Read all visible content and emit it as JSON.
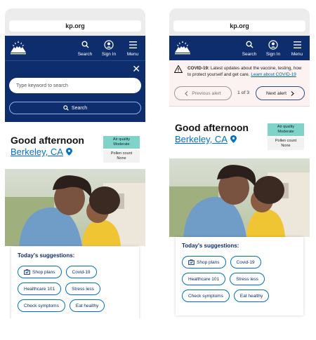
{
  "url": "kp.org",
  "header": {
    "search_label": "Search",
    "signin_label": "Sign In",
    "menu_label": "Menu"
  },
  "search_panel": {
    "placeholder": "Type keyword to search",
    "button_label": "Search"
  },
  "alert": {
    "prefix": "COVID-19:",
    "text": " Latest updates about the vaccine, testing, how to protect yourself and get care.",
    "link": "Learn about COVID-19",
    "prev_label": "Previous alert",
    "count": "1 of 3",
    "next_label": "Next alert"
  },
  "greeting": {
    "text": "Good afternoon",
    "city": "Berkeley, CA"
  },
  "air": {
    "quality_label": "Air quality",
    "quality_value": "Moderate",
    "pollen_label": "Pollen count",
    "pollen_value": "None"
  },
  "suggestions": {
    "title": "Today's suggestions:",
    "chips": [
      "Shop plans",
      "Covid-19",
      "Healthcare 101",
      "Stress less",
      "Check symptoms",
      "Eat healthy"
    ]
  },
  "colors": {
    "navy": "#0d2d6c",
    "link_blue": "#0072c6",
    "air_quality_teal": "#7fd3c9",
    "alert_bg": "#fbf2f1"
  },
  "icons": [
    "kp-logo-icon",
    "search-icon",
    "user-icon",
    "menu-icon",
    "close-icon",
    "warning-icon",
    "chevron-left-icon",
    "chevron-right-icon",
    "location-pin-icon",
    "cart-icon"
  ]
}
